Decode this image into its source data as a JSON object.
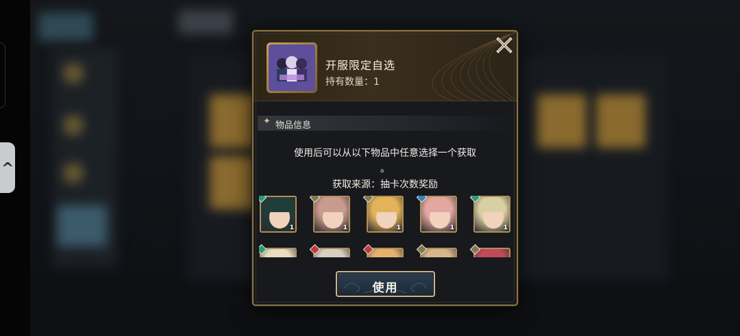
{
  "item": {
    "name": "开服限定自选",
    "count_label": "持有数量：1"
  },
  "section": {
    "title": "物品信息"
  },
  "description": {
    "line1": "使用后可以从以下物品中任意选择一个获取",
    "line2": "。",
    "source": "获取来源：抽卡次数奖励"
  },
  "candidates": [
    {
      "number": "1",
      "element_color": "#2f9b6e",
      "hair_color": "#1f3d3a",
      "row": 0
    },
    {
      "number": "1",
      "element_color": "#8a7550",
      "hair_color": "#c99a8e",
      "row": 0
    },
    {
      "number": "1",
      "element_color": "#8a7550",
      "hair_color": "#e2b35a",
      "row": 0
    },
    {
      "number": "1",
      "element_color": "#3a7fb8",
      "hair_color": "#e2a7a0",
      "row": 0
    },
    {
      "number": "1",
      "element_color": "#2f9b6e",
      "hair_color": "#d8cfa3",
      "row": 0
    },
    {
      "number": "",
      "element_color": "#2f9b6e",
      "hair_color": "#e9dcc2",
      "row": 1
    },
    {
      "number": "",
      "element_color": "#c0393b",
      "hair_color": "#d8cfc4",
      "row": 1
    },
    {
      "number": "",
      "element_color": "#c0393b",
      "hair_color": "#e8b070",
      "row": 1
    },
    {
      "number": "",
      "element_color": "#8a7550",
      "hair_color": "#d8b68c",
      "row": 1
    },
    {
      "number": "",
      "element_color": "#8a7550",
      "hair_color": "#c04a5a",
      "row": 1
    }
  ],
  "button": {
    "use_label": "使用"
  },
  "icons": {
    "close": "close-icon",
    "sparkle": "sparkle-icon"
  },
  "colors": {
    "accent_gold": "#8d7347",
    "button_border": "#c9b58a"
  }
}
